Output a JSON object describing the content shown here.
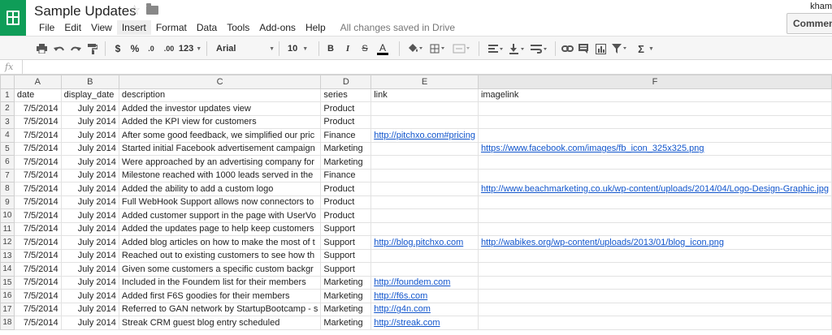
{
  "doc": {
    "title": "Sample Updates",
    "user": "kham",
    "comments_label": "Comments",
    "save_status": "All changes saved in Drive"
  },
  "menu": [
    "File",
    "Edit",
    "View",
    "Insert",
    "Format",
    "Data",
    "Tools",
    "Add-ons",
    "Help"
  ],
  "menu_active_index": 3,
  "toolbar": {
    "currency": "$",
    "percent": "%",
    "dec_decrease": ".0",
    "dec_increase": ".00",
    "number_format": "123",
    "font": "Arial",
    "font_size": "10",
    "bold": "B",
    "italic": "I",
    "strike": "S",
    "text_color": "A",
    "function": "Σ"
  },
  "formula_bar": {
    "fx_label": "fx",
    "value": ""
  },
  "columns": [
    "A",
    "B",
    "C",
    "D",
    "E",
    "F"
  ],
  "selected_column": "F",
  "rows": [
    [
      "date",
      "display_date",
      "description",
      "series",
      "link",
      "imagelink"
    ],
    [
      "7/5/2014",
      "July 2014",
      "Added the investor updates view",
      "Product",
      "",
      ""
    ],
    [
      "7/5/2014",
      "July 2014",
      "Added the KPI view for customers",
      "Product",
      "",
      ""
    ],
    [
      "7/5/2014",
      "July 2014",
      "After some good feedback, we simplified our pric",
      "Finance",
      "http://pitchxo.com#pricing",
      ""
    ],
    [
      "7/5/2014",
      "July 2014",
      "Started initial Facebook advertisement campaign",
      "Marketing",
      "",
      "https://www.facebook.com/images/fb_icon_325x325.png"
    ],
    [
      "7/5/2014",
      "July 2014",
      "Were approached by an advertising company for",
      "Marketing",
      "",
      ""
    ],
    [
      "7/5/2014",
      "July 2014",
      "Milestone reached with 1000 leads served in the",
      "Finance",
      "",
      ""
    ],
    [
      "7/5/2014",
      "July 2014",
      "Added the ability to add a custom logo",
      "Product",
      "",
      "http://www.beachmarketing.co.uk/wp-content/uploads/2014/04/Logo-Design-Graphic.jpg"
    ],
    [
      "7/5/2014",
      "July 2014",
      "Full WebHook Support allows now connectors to",
      "Product",
      "",
      ""
    ],
    [
      "7/5/2014",
      "July 2014",
      "Added customer support in the page with UserVo",
      "Product",
      "",
      ""
    ],
    [
      "7/5/2014",
      "July 2014",
      "Added the updates page to help keep customers",
      "Support",
      "",
      ""
    ],
    [
      "7/5/2014",
      "July 2014",
      "Added blog articles on how to make the most of t",
      "Support",
      "http://blog.pitchxo.com",
      "http://wabikes.org/wp-content/uploads/2013/01/blog_icon.png"
    ],
    [
      "7/5/2014",
      "July 2014",
      "Reached out to existing customers to see how th",
      "Support",
      "",
      ""
    ],
    [
      "7/5/2014",
      "July 2014",
      "Given some customers a specific custom backgr",
      "Support",
      "",
      ""
    ],
    [
      "7/5/2014",
      "July 2014",
      "Included in the Foundem list for their members",
      "Marketing",
      "http://foundem.com",
      ""
    ],
    [
      "7/5/2014",
      "July 2014",
      "Added first F6S goodies for their members",
      "Marketing",
      "http://f6s.com",
      ""
    ],
    [
      "7/5/2014",
      "July 2014",
      "Referred to GAN network by StartupBootcamp - s",
      "Marketing",
      "http://g4n.com",
      ""
    ],
    [
      "7/5/2014",
      "July 2014",
      "Streak CRM guest blog entry scheduled",
      "Marketing",
      "http://streak.com",
      ""
    ]
  ],
  "colors": {
    "brand": "#0f9d58",
    "link": "#1155cc",
    "header_bg": "#f3f3f3"
  }
}
